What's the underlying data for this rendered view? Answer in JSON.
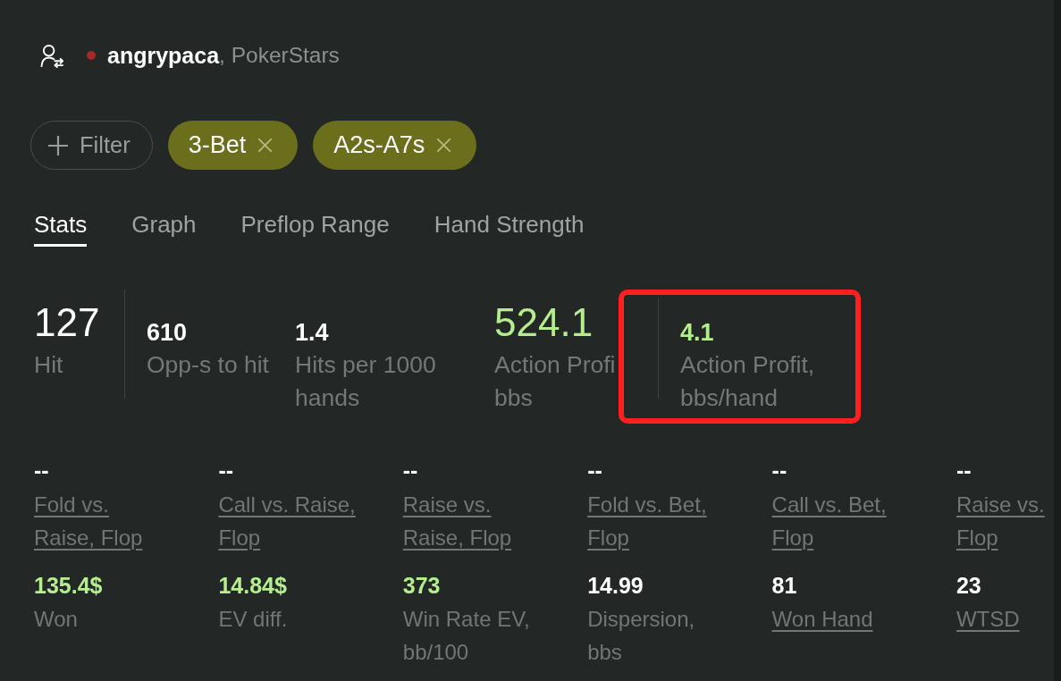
{
  "header": {
    "username": "angrypaca",
    "site": ", PokerStars"
  },
  "filter_button": {
    "label": "Filter"
  },
  "filters": [
    {
      "label": "3-Bet"
    },
    {
      "label": "A2s-A7s"
    }
  ],
  "tabs": [
    {
      "label": "Stats",
      "selected": true
    },
    {
      "label": "Graph",
      "selected": false
    },
    {
      "label": "Preflop Range",
      "selected": false
    },
    {
      "label": "Hand Strength",
      "selected": false
    }
  ],
  "summary_stats": [
    {
      "kind": "large",
      "value": "127",
      "label": [
        "Hit"
      ],
      "positive": false,
      "separator": false,
      "annotated": false
    },
    {
      "kind": "small",
      "value": "610",
      "label": [
        "Opp-s to hit"
      ],
      "positive": false,
      "separator": true,
      "annotated": false
    },
    {
      "kind": "small",
      "value": "1.4",
      "label": [
        "Hits per 1000",
        "hands"
      ],
      "positive": false,
      "separator": false,
      "annotated": false
    },
    {
      "kind": "large",
      "value": "524.1",
      "label": [
        "Action Profi",
        "bbs"
      ],
      "positive": true,
      "separator": false,
      "annotated": false
    },
    {
      "kind": "small",
      "value": "4.1",
      "label": [
        "Action Profit,",
        "bbs/hand"
      ],
      "positive": true,
      "separator": true,
      "annotated": true
    }
  ],
  "action_stats": [
    {
      "value": "--",
      "label": [
        "Fold vs.",
        "Raise, Flop"
      ],
      "positive": false,
      "linked": true
    },
    {
      "value": "--",
      "label": [
        "Call vs. Raise,",
        "Flop"
      ],
      "positive": false,
      "linked": true
    },
    {
      "value": "--",
      "label": [
        "Raise vs.",
        "Raise, Flop"
      ],
      "positive": false,
      "linked": true
    },
    {
      "value": "--",
      "label": [
        "Fold vs. Bet,",
        "Flop"
      ],
      "positive": false,
      "linked": true
    },
    {
      "value": "--",
      "label": [
        "Call vs. Bet,",
        "Flop"
      ],
      "positive": false,
      "linked": true
    },
    {
      "value": "--",
      "label": [
        "Raise vs.",
        "Flop"
      ],
      "positive": false,
      "linked": true
    }
  ],
  "result_stats": [
    {
      "value": "135.4$",
      "label": [
        "Won"
      ],
      "positive": true,
      "linked": false
    },
    {
      "value": "14.84$",
      "label": [
        "EV diff."
      ],
      "positive": true,
      "linked": false
    },
    {
      "value": "373",
      "label": [
        "Win Rate EV,",
        "bb/100"
      ],
      "positive": true,
      "linked": false
    },
    {
      "value": "14.99",
      "label": [
        "Dispersion,",
        "bbs"
      ],
      "positive": false,
      "linked": false
    },
    {
      "value": "81",
      "label": [
        "Won Hand"
      ],
      "positive": false,
      "linked": true
    },
    {
      "value": "23",
      "label": [
        "WTSD"
      ],
      "positive": false,
      "linked": true
    }
  ]
}
